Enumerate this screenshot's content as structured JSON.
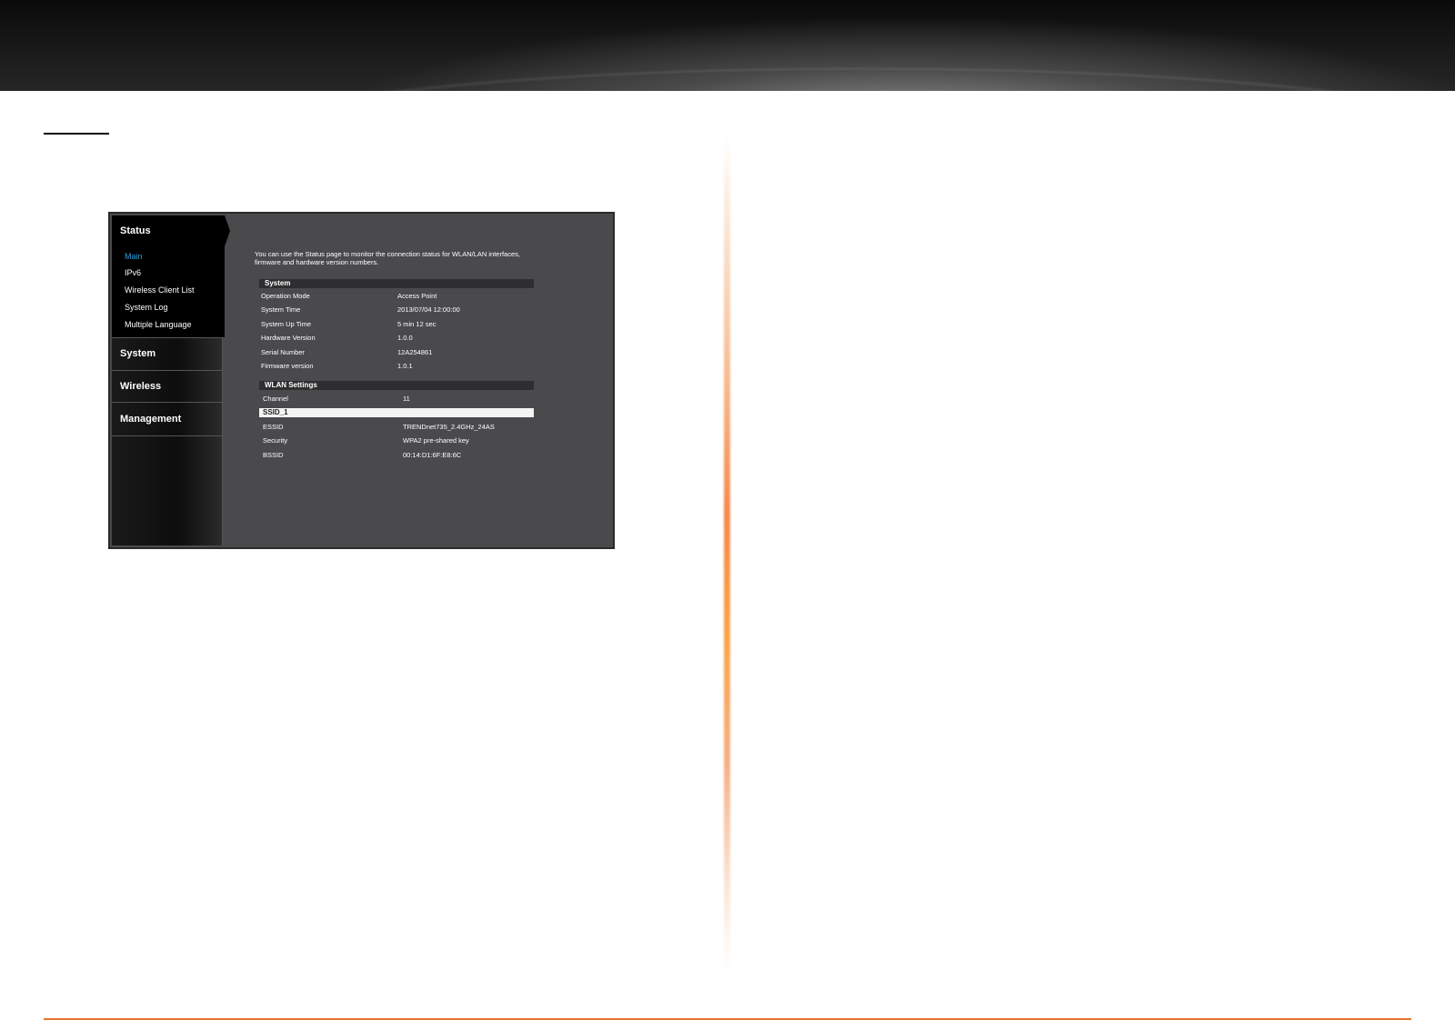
{
  "sidebar": {
    "status_title": "Status",
    "status_items": [
      "Main",
      "IPv6",
      "Wireless Client List",
      "System Log",
      "Multiple Language"
    ],
    "active_item": "Main",
    "sections": [
      "System",
      "Wireless",
      "Management"
    ]
  },
  "content": {
    "intro": "You can use the Status page to monitor the connection status for WLAN/LAN interfaces, firmware and hardware version numbers.",
    "system_header": "System",
    "system_rows": [
      {
        "label": "Operation Mode",
        "value": "Access Point"
      },
      {
        "label": "System Time",
        "value": "2013/07/04 12:00:00"
      },
      {
        "label": "System Up Time",
        "value": "5 min 12 sec"
      },
      {
        "label": "Hardware Version",
        "value": "1.0.0"
      },
      {
        "label": "Serial Number",
        "value": "12A254861"
      },
      {
        "label": "Firmware version",
        "value": "1.0.1"
      }
    ],
    "wlan_header": "WLAN Settings",
    "channel": {
      "label": "Channel",
      "value": "11"
    },
    "ssid_header": "SSID_1",
    "ssid_rows": [
      {
        "label": "ESSID",
        "value": "TRENDnet735_2.4GHz_24AS"
      },
      {
        "label": "Security",
        "value": "WPA2 pre-shared key"
      },
      {
        "label": "BSSID",
        "value": "00:14:D1:6F:E8:6C"
      }
    ]
  },
  "colors": {
    "accent": "#e8762d",
    "active_link": "#2aa2e6",
    "panel": "#4a4a4d"
  }
}
